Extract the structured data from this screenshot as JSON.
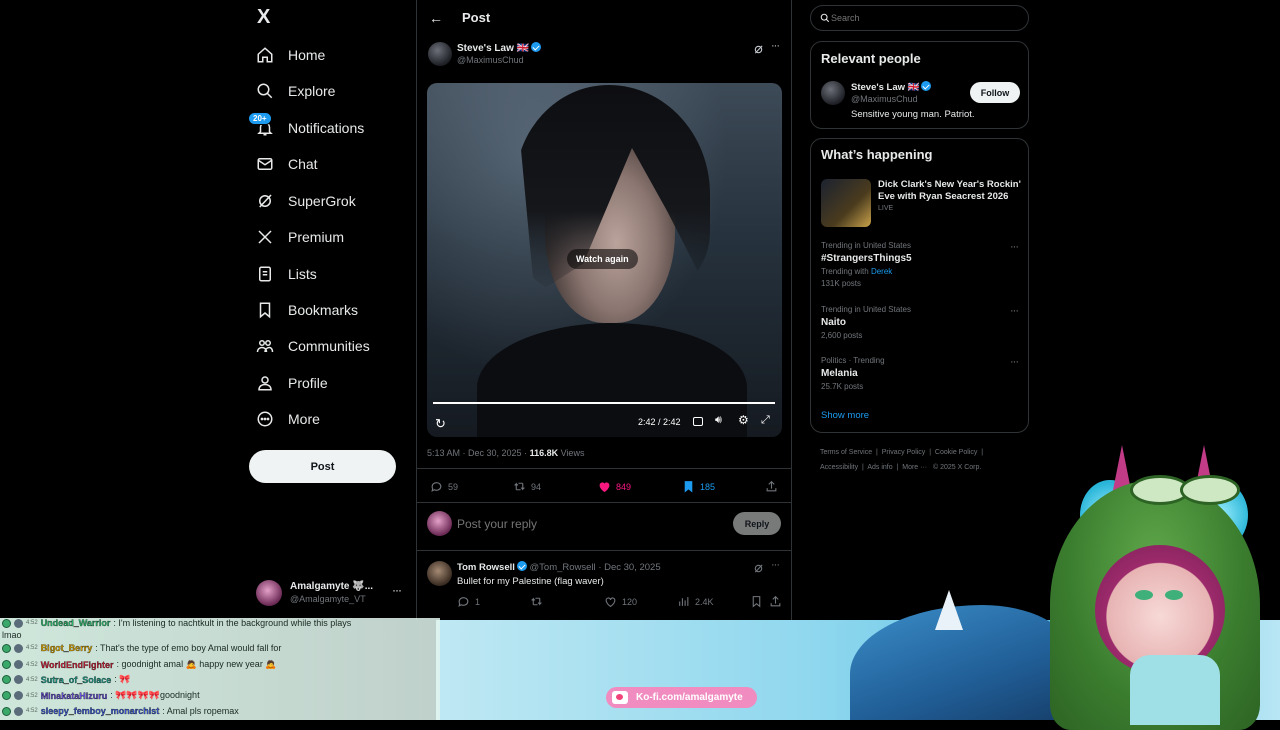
{
  "nav": {
    "logo": "X",
    "items": [
      {
        "label": "Home",
        "icon": "home-icon"
      },
      {
        "label": "Explore",
        "icon": "search-icon"
      },
      {
        "label": "Notifications",
        "icon": "bell-icon",
        "badge": "20+"
      },
      {
        "label": "Chat",
        "icon": "mail-icon"
      },
      {
        "label": "SuperGrok",
        "icon": "grok-icon"
      },
      {
        "label": "Premium",
        "icon": "x-icon"
      },
      {
        "label": "Lists",
        "icon": "list-icon"
      },
      {
        "label": "Bookmarks",
        "icon": "bookmark-icon"
      },
      {
        "label": "Communities",
        "icon": "people-icon"
      },
      {
        "label": "Profile",
        "icon": "user-icon"
      },
      {
        "label": "More",
        "icon": "more-circle-icon"
      }
    ],
    "post_button": "Post",
    "account": {
      "name": "Amalgamyte 🐺...",
      "handle": "@Amalgamyte_VT"
    }
  },
  "header": {
    "title": "Post"
  },
  "post": {
    "author": {
      "name": "Steve's Law 🇬🇧",
      "handle": "@MaximusChud"
    },
    "video": {
      "overlay": "Watch again",
      "time": "2:42 / 2:42",
      "progress": 1.0
    },
    "meta": {
      "time": "5:13 AM · Dec 30, 2025 · ",
      "views": "116.8K",
      "views_label": " Views"
    },
    "actions": {
      "replies": "59",
      "reposts": "94",
      "likes": "849",
      "bookmarks": "185"
    }
  },
  "reply_box": {
    "placeholder": "Post your reply",
    "button": "Reply"
  },
  "reply": {
    "name": "Tom Rowsell",
    "handle": "@Tom_Rowsell",
    "date": "· Dec 30, 2025",
    "text": "Bullet for my Palestine (flag waver)",
    "replies": "1",
    "likes": "120",
    "views": "2.4K"
  },
  "search": {
    "placeholder": "Search"
  },
  "relevant": {
    "title": "Relevant people",
    "name": "Steve's Law 🇬🇧",
    "handle": "@MaximusChud",
    "bio": "Sensitive young man. Patriot.",
    "follow": "Follow"
  },
  "happening": {
    "title": "What’s happening",
    "featured": {
      "title": "Dick Clark's New Year's Rockin' Eve with Ryan Seacrest 2026",
      "status": "LIVE"
    },
    "trends": [
      {
        "meta": "Trending in United States",
        "title": "#StrangersThings5",
        "with_label": "Trending with ",
        "with": "Derek",
        "posts": "131K posts"
      },
      {
        "meta": "Trending in United States",
        "title": "Naito",
        "posts": "2,600 posts"
      },
      {
        "meta": "Politics · Trending",
        "title": "Melania",
        "posts": "25.7K posts"
      }
    ],
    "show_more": "Show more"
  },
  "footer": {
    "line1": [
      "Terms of Service",
      "Privacy Policy",
      "Cookie Policy"
    ],
    "line2": [
      "Accessibility",
      "Ads info",
      "More ···",
      "© 2025 X Corp."
    ]
  },
  "stream": {
    "chat": [
      {
        "time": "4:52",
        "user": "Undead_Warrior",
        "color": "#2dbd6e",
        "msg": ": I'm listening to nachtkult in the background while this plays"
      },
      {
        "time": "",
        "user": "",
        "color": "#1a2a22",
        "msg": "lmao"
      },
      {
        "time": "4:52",
        "user": "Bigot_Berry",
        "color": "#e0a800",
        "msg": ": That's the type of emo boy Amal would fall for"
      },
      {
        "time": "4:52",
        "user": "WorldEndFighter",
        "color": "#d0213a",
        "msg": ": goodnight amal 🙇 happy new year 🙇"
      },
      {
        "time": "4:52",
        "user": "Sutra_of_Solace",
        "color": "#1f9d8a",
        "msg": ": 🎀"
      },
      {
        "time": "4:52",
        "user": "MinakataHizuru",
        "color": "#6a4fd8",
        "msg": ": 🎀🎀🎀🎀goodnight"
      },
      {
        "time": "4:52",
        "user": "sleepy_femboy_monarchist",
        "color": "#3c5bd6",
        "msg": ": Amal pls ropemax"
      }
    ],
    "kofi": "Ko-fi.com/amalgamyte"
  }
}
